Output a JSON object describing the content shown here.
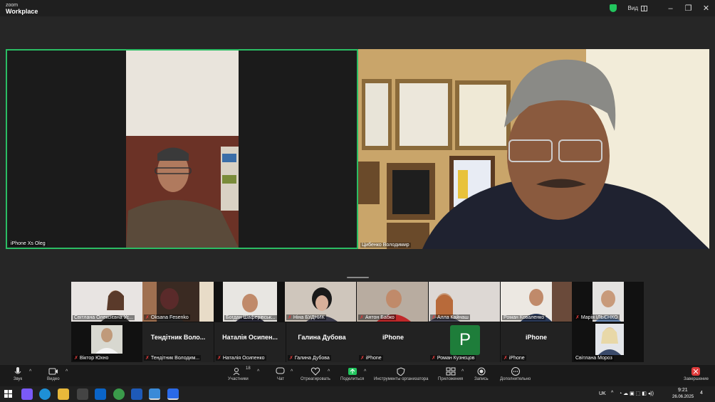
{
  "app": {
    "logo_top": "zoom",
    "logo_bottom": "Workplace",
    "view_label": "Вид"
  },
  "window_controls": {
    "minimize": "–",
    "maximize": "❐",
    "close": "✕"
  },
  "main_videos": [
    {
      "name": "iPhone Xs Oleg"
    },
    {
      "name": "Цибенко Володимир"
    }
  ],
  "gallery": [
    {
      "name": "Світлана Олексієвна Ус...",
      "muted": false
    },
    {
      "name": "Oksana Fesenko",
      "muted": true
    },
    {
      "name": "Богдан Шаферівськ...",
      "muted": false
    },
    {
      "name": "Ніна БУДНИК",
      "muted": true
    },
    {
      "name": "Антон Бабко",
      "muted": true
    },
    {
      "name": "Алла Кайнаш",
      "muted": true
    },
    {
      "name": "Роман Коваленко",
      "muted": false
    },
    {
      "name": "Марія ІЛЬЄНКО",
      "muted": true
    },
    {
      "name": "Віктор Юхно",
      "muted": true
    },
    {
      "name": "Тендітник Володим...",
      "muted": true,
      "big": "Тендітник Воло..."
    },
    {
      "name": "Наталія Осипенко",
      "muted": true,
      "big": "Наталія Осипен..."
    },
    {
      "name": "Галина Дубова",
      "muted": true,
      "big": "Галина Дубова"
    },
    {
      "name": "iPhone",
      "muted": true,
      "big": "iPhone"
    },
    {
      "name": "Роман Кузнєцов",
      "muted": true,
      "avatar": "P"
    },
    {
      "name": "iPhone",
      "muted": true,
      "big": "iPhone"
    },
    {
      "name": "Світлана Мороз",
      "muted": false
    }
  ],
  "toolbar": {
    "audio": "Звук",
    "video": "Видео",
    "participants": "Участники",
    "participants_count": "18",
    "chat": "Чат",
    "react": "Отреагировать",
    "share": "Поделиться",
    "host_tools": "Инструменты организатора",
    "apps": "Приложения",
    "record": "Запись",
    "more": "Дополнительно",
    "end": "Завершение"
  },
  "taskbar": {
    "lang": "UK",
    "time": "9:21",
    "date": "26.06.2025",
    "notifications": "4"
  },
  "colors": {
    "active_border": "#2bbd64",
    "end_red": "#e03b3b",
    "share_green": "#22c55e"
  }
}
